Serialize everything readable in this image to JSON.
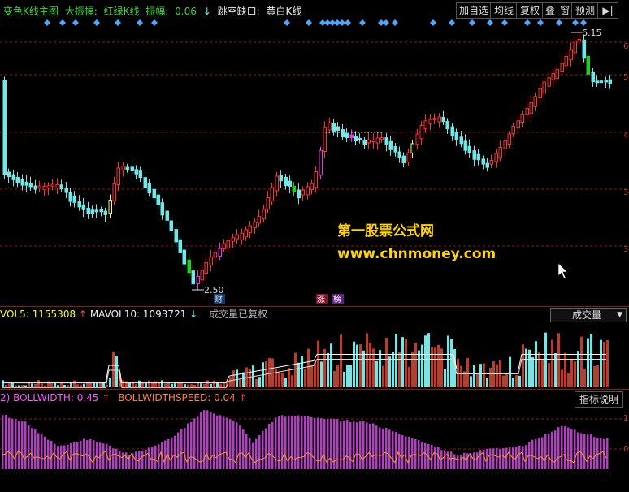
{
  "header": {
    "title": "变色K线主图",
    "amplitude_label": "大振幅:",
    "redgreen_label": "红绿K线",
    "zhenfu_label": "振幅:",
    "zhenfu_value": "0.06",
    "gap_label": "跳空缺口:",
    "gap_value": "黄白K线"
  },
  "toolbar": {
    "add_watchlist": "加自选",
    "avg_line": "均线",
    "fuquan": "复权",
    "overlay": "叠",
    "window": "窗",
    "forecast": "预测",
    "nav": "▶|"
  },
  "main_chart": {
    "high_label": "6.15",
    "low_label": "2.50",
    "tag_cai": "财",
    "tag_zhang": "涨",
    "tag_bang": "榜",
    "axis_labels": [
      "6",
      "5",
      "4",
      "3",
      "3"
    ],
    "watermark_name": "第一股票公式网",
    "watermark_url": "www.chnmoney.com"
  },
  "volume_panel": {
    "vol5_label": "VOL5:",
    "vol5_value": "1155308",
    "mavol10_label": "MAVOL10:",
    "mavol10_value": "1093721",
    "note": "成交量已复权",
    "selector": "成交量"
  },
  "indicator_panel": {
    "prefix": "2)",
    "bw_label": "BOLLWIDTH:",
    "bw_value": "0.45",
    "bws_label": "BOLLWIDTHSPEED:",
    "bws_value": "0.04",
    "help_button": "指标说明",
    "axis_labels": [
      "1",
      "0"
    ]
  },
  "colors": {
    "up": "#ff3030",
    "down": "#6fe8e8",
    "green": "#22cc22",
    "magenta": "#ee33ee",
    "yellow": "#ffff33",
    "grid": "#8b1a1a",
    "purple_bar": "#b040c0",
    "orange_line": "#ff9933"
  }
}
